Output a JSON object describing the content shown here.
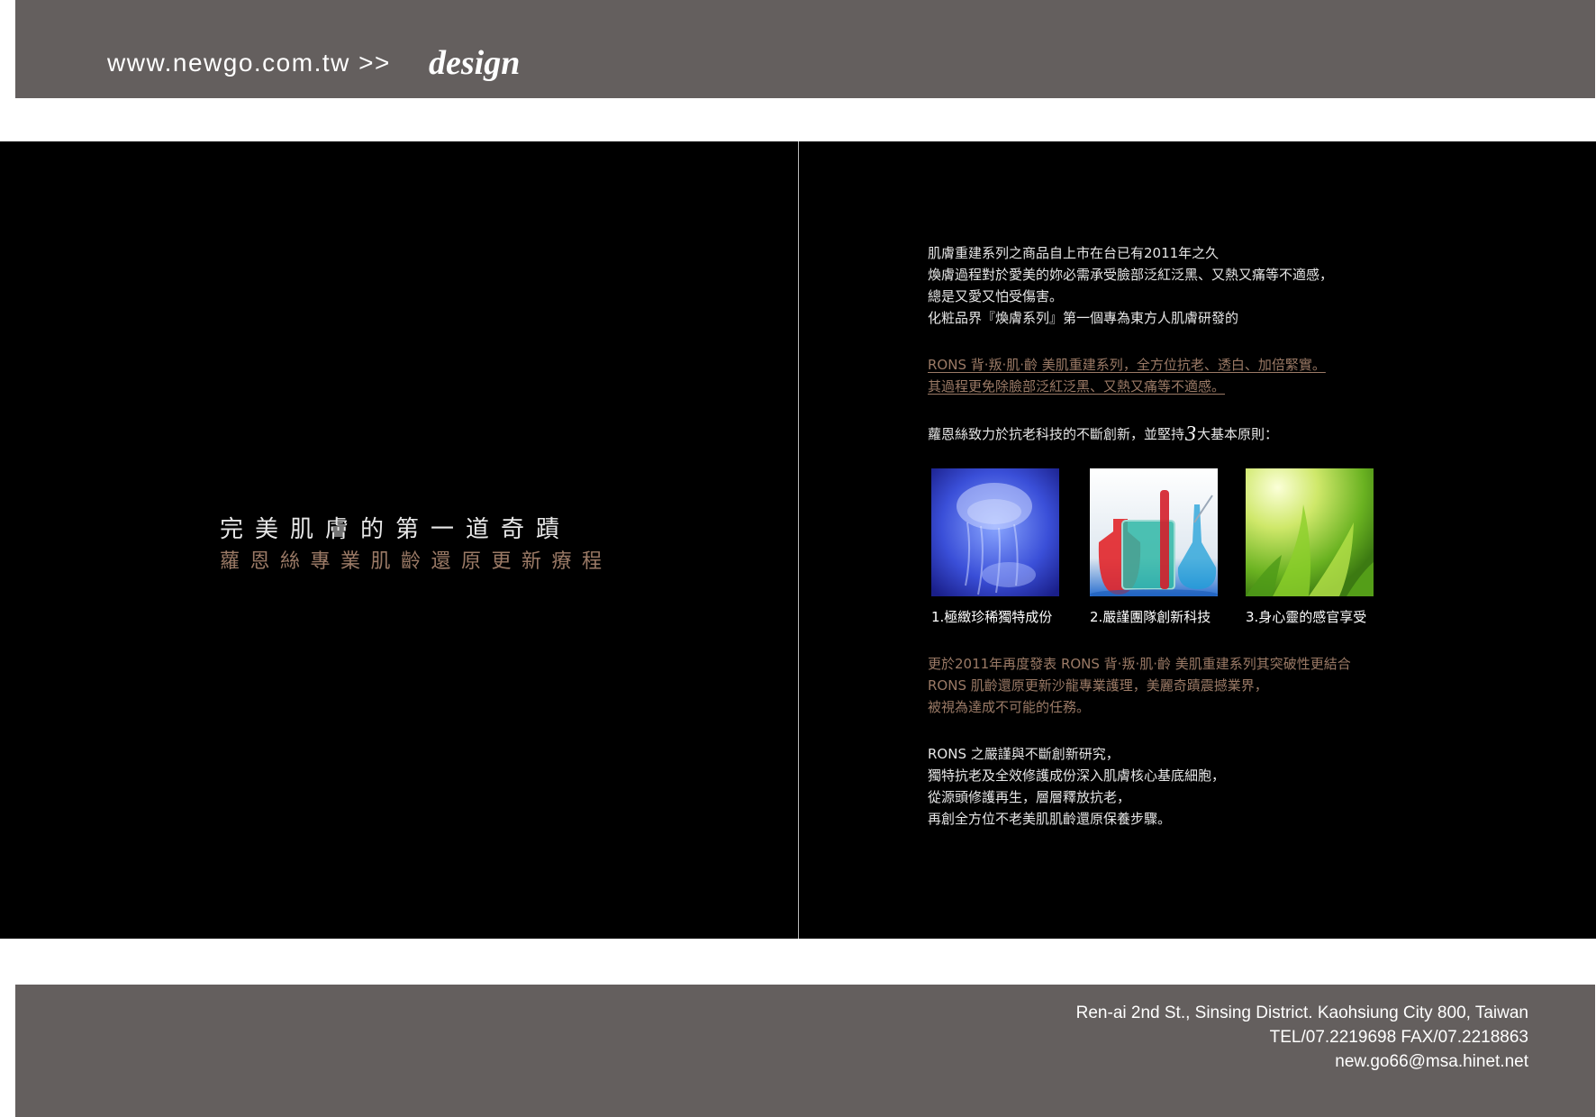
{
  "header": {
    "url": "www.newgo.com.tw >>",
    "section": "design"
  },
  "left_page": {
    "headline": "完美肌膚的第一道奇蹟",
    "subheadline": "蘿恩絲專業肌齡還原更新療程"
  },
  "right_page": {
    "intro_lines": [
      "肌膚重建系列之商品自上市在台已有2011年之久",
      "煥膚過程對於愛美的妳必需承受臉部泛紅泛黑、又熱又痛等不適感，",
      "總是又愛又怕受傷害。",
      "化粧品界『煥膚系列』第一個專為東方人肌膚研發的"
    ],
    "highlight_lines": [
      "RONS 背·叛·肌·齡  美肌重建系列，全方位抗老、透白、加倍緊實。",
      "其過程更免除臉部泛紅泛黑、又熱又痛等不適感。"
    ],
    "principles": {
      "before": "蘿恩絲致力於抗老科技的不斷創新，並堅持",
      "number": "3",
      "after": "大基本原則："
    },
    "features": [
      {
        "caption": "1.極緻珍稀獨特成份",
        "image": "jellyfish-photo"
      },
      {
        "caption": "2.嚴謹團隊創新科技",
        "image": "lab-flasks-photo"
      },
      {
        "caption": "3.身心靈的感官享受",
        "image": "green-leaves-photo"
      }
    ],
    "accent_lines": [
      "更於2011年再度發表 RONS 背·叛·肌·齡  美肌重建系列其突破性更結合",
      "RONS 肌齡還原更新沙龍專業護理，美麗奇蹟震撼業界，",
      "被視為達成不可能的任務。"
    ],
    "closing_lines": [
      "RONS 之嚴謹與不斷創新研究，",
      "獨特抗老及全效修護成份深入肌膚核心基底細胞，",
      "從源頭修護再生，層層釋放抗老，",
      "再創全方位不老美肌肌齡還原保養步驟。"
    ]
  },
  "footer": {
    "address": "Ren-ai 2nd St., Sinsing District. Kaohsiung City 800, Taiwan",
    "phone_fax": "TEL/07.2219698   FAX/07.2218863",
    "email": "new.go66@msa.hinet.net"
  },
  "colors": {
    "header_bar": "#645f5e",
    "page_background": "#000000",
    "accent_text": "#9b7a66"
  }
}
